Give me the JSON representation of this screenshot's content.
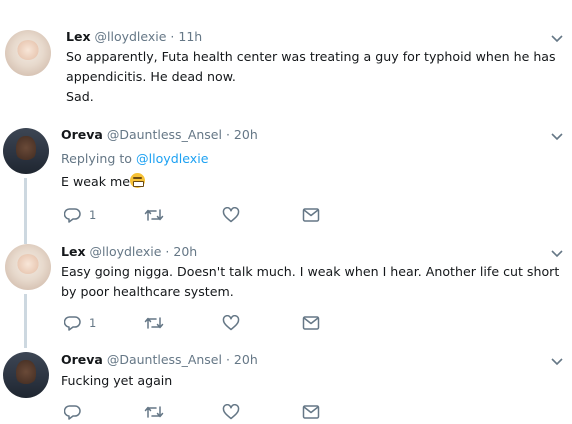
{
  "tweets": [
    {
      "name": "Lex",
      "handle": "@lloydlexie",
      "time": "11h",
      "text_lines": [
        "So apparently, Futa health center was treating a guy for typhoid when he has",
        "appendicitis. He dead now.",
        "Sad."
      ],
      "avatar": "lex-avatar"
    },
    {
      "name": "Oreva",
      "handle": "@Dauntless_Ansel",
      "time": "20h",
      "replying_label": "Replying to",
      "replying_handle": "@lloydlexie",
      "text": "E weak me",
      "emoji": "weary-face-emoji",
      "reply_count": "1"
    },
    {
      "name": "Lex",
      "handle": "@lloydlexie",
      "time": "20h",
      "text_lines": [
        "Easy going nigga. Doesn't talk much. I weak when I hear. Another life cut short",
        "by poor healthcare system."
      ],
      "reply_count": "1"
    },
    {
      "name": "Oreva",
      "handle": "@Dauntless_Ansel",
      "time": "20h",
      "text": "Fucking yet again"
    }
  ],
  "separator": "·",
  "icons": {
    "reply": "reply-icon",
    "retweet": "retweet-icon",
    "like": "heart-icon",
    "dm": "envelope-icon",
    "menu": "chevron-down-icon"
  },
  "colors": {
    "link": "#1da1f2",
    "muted": "#657786",
    "thread_line": "#cdd8e0"
  }
}
